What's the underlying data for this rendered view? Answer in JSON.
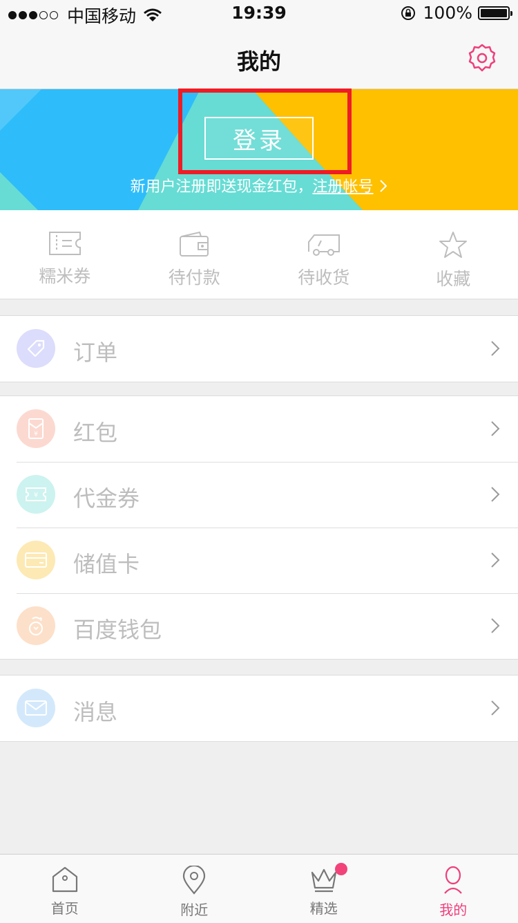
{
  "status_bar": {
    "carrier": "中国移动",
    "time": "19:39",
    "battery_percent": "100%",
    "signal_bars_filled": 3,
    "signal_bars_total": 5
  },
  "nav": {
    "title": "我的",
    "settings_icon": "gear-icon",
    "accent_color": "#ee3f7c"
  },
  "banner": {
    "login_label": "登录",
    "promo_text": "新用户注册即送现金红包，",
    "register_link": "注册帐号",
    "colors": {
      "blue": "#2ebdfa",
      "teal": "#66dcd4",
      "yellow": "#ffc000"
    }
  },
  "quick_actions": [
    {
      "label": "糯米券",
      "icon": "ticket-icon"
    },
    {
      "label": "待付款",
      "icon": "wallet-icon"
    },
    {
      "label": "待收货",
      "icon": "truck-icon"
    },
    {
      "label": "收藏",
      "icon": "star-icon"
    }
  ],
  "menu": {
    "orders": {
      "label": "订单",
      "icon": "tag-icon",
      "color": "#dcdcfc"
    },
    "red_packet": {
      "label": "红包",
      "icon": "red-envelope-icon",
      "color": "#fcd9d0"
    },
    "voucher": {
      "label": "代金券",
      "icon": "coupon-icon",
      "color": "#ccf3ef"
    },
    "stored_card": {
      "label": "储值卡",
      "icon": "card-icon",
      "color": "#fde9b4"
    },
    "baidu_wallet": {
      "label": "百度钱包",
      "icon": "money-bag-icon",
      "color": "#fde0c9"
    },
    "messages": {
      "label": "消息",
      "icon": "envelope-icon",
      "color": "#d3e9fb"
    }
  },
  "tabbar": [
    {
      "label": "首页",
      "icon": "home-icon"
    },
    {
      "label": "附近",
      "icon": "location-pin-icon"
    },
    {
      "label": "精选",
      "icon": "crown-icon"
    },
    {
      "label": "我的",
      "icon": "profile-icon"
    }
  ]
}
